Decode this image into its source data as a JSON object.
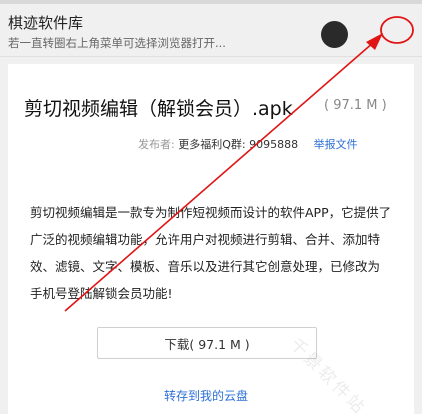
{
  "header": {
    "title": "棋迹软件库",
    "subtitle": "若一直转圈右上角菜单可选择浏览器打开..."
  },
  "file": {
    "title": "剪切视频编辑（解锁会员）.apk",
    "size": "( 97.1 M )"
  },
  "publisher": {
    "label": "发布者:",
    "name": "更多福利Q群: 9095888",
    "report_label": "举报文件"
  },
  "description": "剪切视频编辑是一款专为制作短视频而设计的软件APP，它提供了广泛的视频编辑功能，允许用户对视频进行剪辑、合并、添加特效、滤镜、文字、模板、音乐以及进行其它创意处理，已修改为手机号登陆解锁会员功能!",
  "actions": {
    "download_label": "下载( 97.1 M )",
    "save_label": "转存到我的云盘"
  },
  "watermark": "千景软件站",
  "colors": {
    "annotation": "#e01515",
    "link": "#2c6fd6"
  }
}
